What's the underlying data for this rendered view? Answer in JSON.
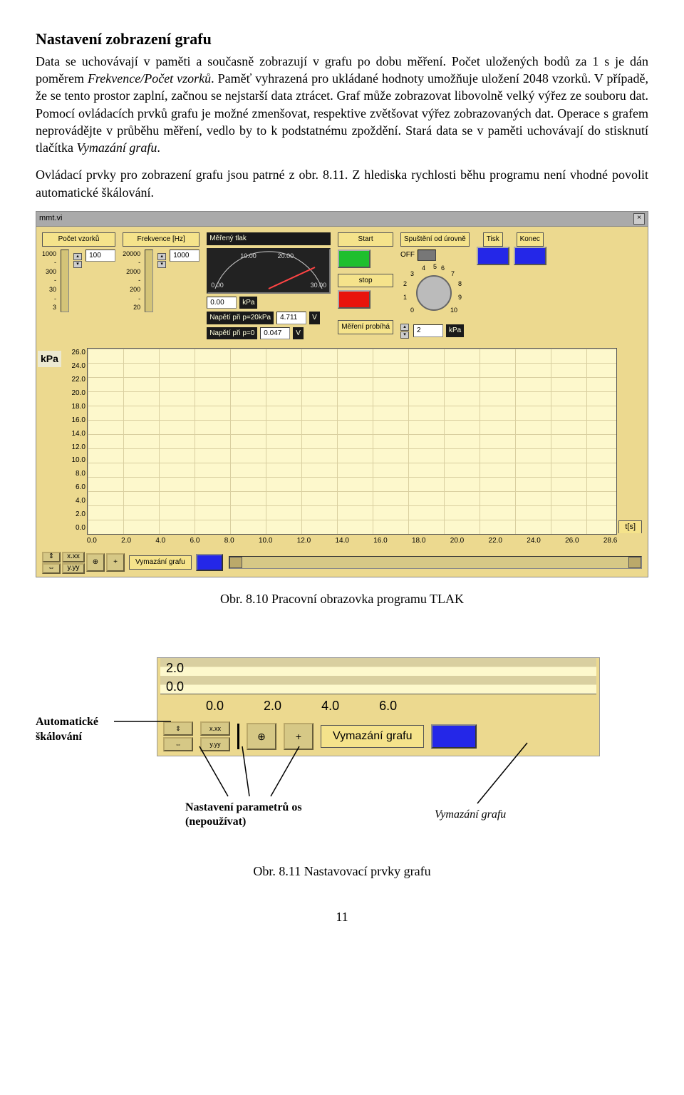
{
  "heading": "Nastavení zobrazení grafu",
  "para1_a": "Data se uchovávají v paměti a současně zobrazují v grafu po dobu měření. Počet uložených bodů za 1 s je dán poměrem ",
  "para1_b": "Frekvence/Počet vzorků",
  "para1_c": ". Paměť vyhrazená pro ukládané hodnoty umožňuje uložení 2048 vzorků. V případě, že se tento prostor zaplní, začnou se nejstarší data ztrácet. Graf může zobrazovat libovolně velký výřez ze souboru dat. Pomocí ovládacích prvků grafu je možné zmenšovat, respektive zvětšovat výřez zobrazovaných dat. Operace s grafem neprovádějte v průběhu měření, vedlo by to k podstatnému zpoždění. Stará data se v paměti uchovávají do stisknutí tlačítka ",
  "para1_d": "Vymazání grafu",
  "para1_e": ".",
  "para2": "Ovládací prvky pro zobrazení grafu jsou patrné z obr. 8.11. Z hlediska rychlosti běhu programu není vhodné povolit automatické škálování.",
  "caption1": "Obr. 8.10  Pracovní obrazovka programu TLAK",
  "caption2": "Obr. 8.11  Nastavovací prvky grafu",
  "annot_auto": "Automatické škálování",
  "annot_param_a": "Nastavení parametrů os",
  "annot_param_b": "(nepoužívat)",
  "annot_vymaz": "Vymazání grafu",
  "page_number": "11",
  "window": {
    "title": "mmt.vi",
    "close": "×",
    "pocet_label": "Počet vzorků",
    "pocet_value": "100",
    "pocet_scale": [
      "1000",
      "300",
      "30",
      "3"
    ],
    "frekv_label": "Frekvence [Hz]",
    "frekv_value": "1000",
    "frekv_scale": [
      "20000",
      "2000",
      "200",
      "20"
    ],
    "mtlak_label": "Měřený tlak",
    "gauge_vals": [
      "0.00",
      "10.00",
      "20.00",
      "30.00"
    ],
    "gauge_readout": "0.00",
    "gauge_unit": "kPa",
    "nap20_label": "Napětí při p=20kPa",
    "nap20_val": "4.711",
    "nap0_label": "Napětí při p=0",
    "nap0_val": "0.047",
    "unit_v": "V",
    "start": "Start",
    "stop": "stop",
    "spusteni": "Spuštění od úrovně",
    "off": "OFF",
    "knob_val": "2",
    "knob_unit": "kPa",
    "knob_ticks": [
      "0",
      "1",
      "2",
      "3",
      "4",
      "5",
      "6",
      "7",
      "8",
      "9",
      "10"
    ],
    "tisk": "Tisk",
    "konec": "Konec",
    "mereni": "Měření probíhá",
    "ylabel": "kPa",
    "yticks": [
      "26.0",
      "24.0",
      "22.0",
      "20.0",
      "18.0",
      "16.0",
      "14.0",
      "12.0",
      "10.0",
      "8.0",
      "6.0",
      "4.0",
      "2.0",
      "0.0"
    ],
    "xticks": [
      "0.0",
      "2.0",
      "4.0",
      "6.0",
      "8.0",
      "10.0",
      "12.0",
      "14.0",
      "16.0",
      "18.0",
      "20.0",
      "22.0",
      "24.0",
      "26.0",
      "28.6"
    ],
    "xunit": "t[s]",
    "vymaz_label": "Vymazání grafu",
    "toolbtns": [
      "⇕",
      "x.xx",
      "⊕",
      "+"
    ],
    "toolbtns2": [
      "⇔",
      "y.yy",
      "⤢",
      "⌖"
    ]
  },
  "frag": {
    "yvals": [
      "2.0",
      "0.0"
    ],
    "xvals": [
      "0.0",
      "2.0",
      "4.0",
      "6.0"
    ],
    "toolbtns": [
      "⇕",
      "x.xx",
      "⊕",
      "+"
    ],
    "toolbtns2": [
      "⇔",
      "y.yy",
      "⤢"
    ],
    "vymaz": "Vymazání grafu"
  },
  "chart_data": {
    "type": "line",
    "title": "",
    "xlabel": "t[s]",
    "ylabel": "kPa",
    "series": [],
    "categories": [
      "0.0",
      "2.0",
      "4.0",
      "6.0",
      "8.0",
      "10.0",
      "12.0",
      "14.0",
      "16.0",
      "18.0",
      "20.0",
      "22.0",
      "24.0",
      "26.0",
      "28.6"
    ],
    "xlim": [
      0.0,
      28.6
    ],
    "ylim": [
      0.0,
      26.0
    ]
  }
}
